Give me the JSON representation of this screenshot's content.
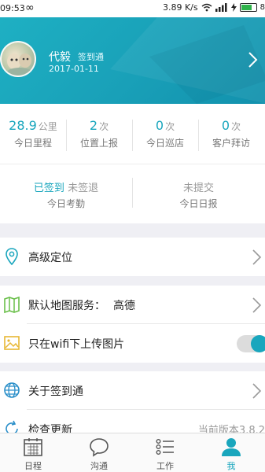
{
  "status_bar": {
    "time": "09:53",
    "speed": "3.89 K/s",
    "battery": "8"
  },
  "profile": {
    "name": "代毅",
    "app_tag": "签到通",
    "date": "2017-01-11"
  },
  "stats": [
    {
      "value": "28.9",
      "unit": "公里",
      "label": "今日里程"
    },
    {
      "value": "2",
      "unit": "次",
      "label": "位置上报"
    },
    {
      "value": "0",
      "unit": "次",
      "label": "今日巡店"
    },
    {
      "value": "0",
      "unit": "次",
      "label": "客户拜访"
    }
  ],
  "attendance": {
    "signed_in": "已签到",
    "signed_out": "未签退",
    "label": "今日考勤"
  },
  "daily_report": {
    "status": "未提交",
    "label": "今日日报"
  },
  "menu": {
    "location": "高级定位",
    "map_service_label": "默认地图服务：",
    "map_service_value": "高德",
    "wifi_upload": "只在wifi下上传图片",
    "about": "关于签到通",
    "check_update": "检查更新",
    "current_version": "当前版本3.8.2"
  },
  "tabs": [
    {
      "label": "日程"
    },
    {
      "label": "沟通"
    },
    {
      "label": "工作"
    },
    {
      "label": "我"
    }
  ],
  "colors": {
    "accent": "#19a6bd",
    "header_bg": "#1ba8bf",
    "toggle_on": "#19a6bd"
  }
}
